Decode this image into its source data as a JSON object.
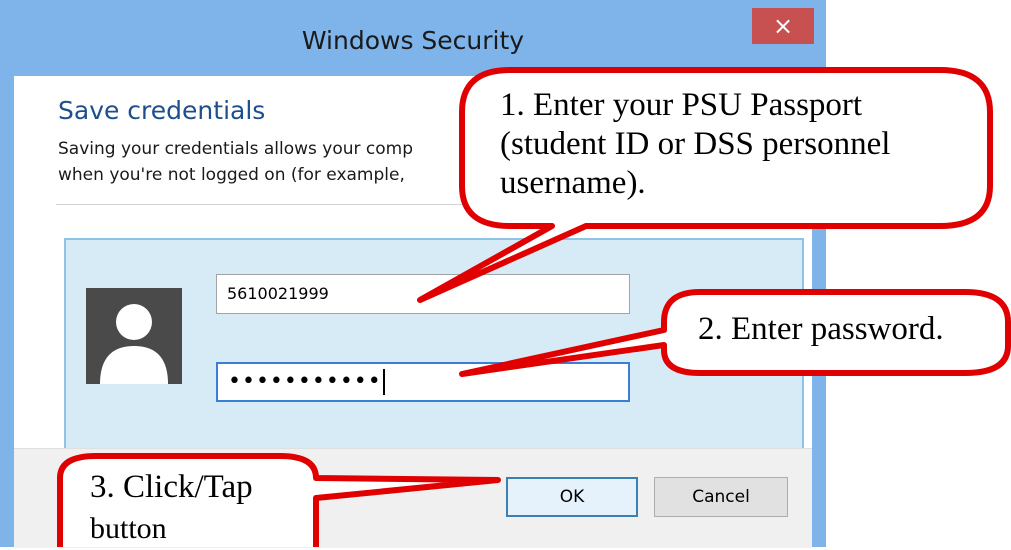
{
  "window": {
    "title": "Windows Security",
    "close_label": "×"
  },
  "dialog": {
    "heading": "Save credentials",
    "description_line1": "Saving your credentials allows your comp",
    "description_line2": "when you're not logged on (for example, "
  },
  "credentials": {
    "username_value": "5610021999",
    "password_masked": "•••••••••••"
  },
  "buttons": {
    "ok_label": "OK",
    "cancel_label": "Cancel"
  },
  "callouts": {
    "step1_line1": "1. Enter your PSU Passport",
    "step1_line2": "(student ID or DSS personnel",
    "step1_line3": "username).",
    "step2": "2. Enter password.",
    "step3_line1": "3. Click/Tap",
    "step3_line2": "button"
  },
  "colors": {
    "titlebar": "#7eb4ea",
    "close_button": "#c75050",
    "heading": "#1e4f8c",
    "credential_box": "#d7ebf7",
    "callout_outline": "#e00000"
  }
}
